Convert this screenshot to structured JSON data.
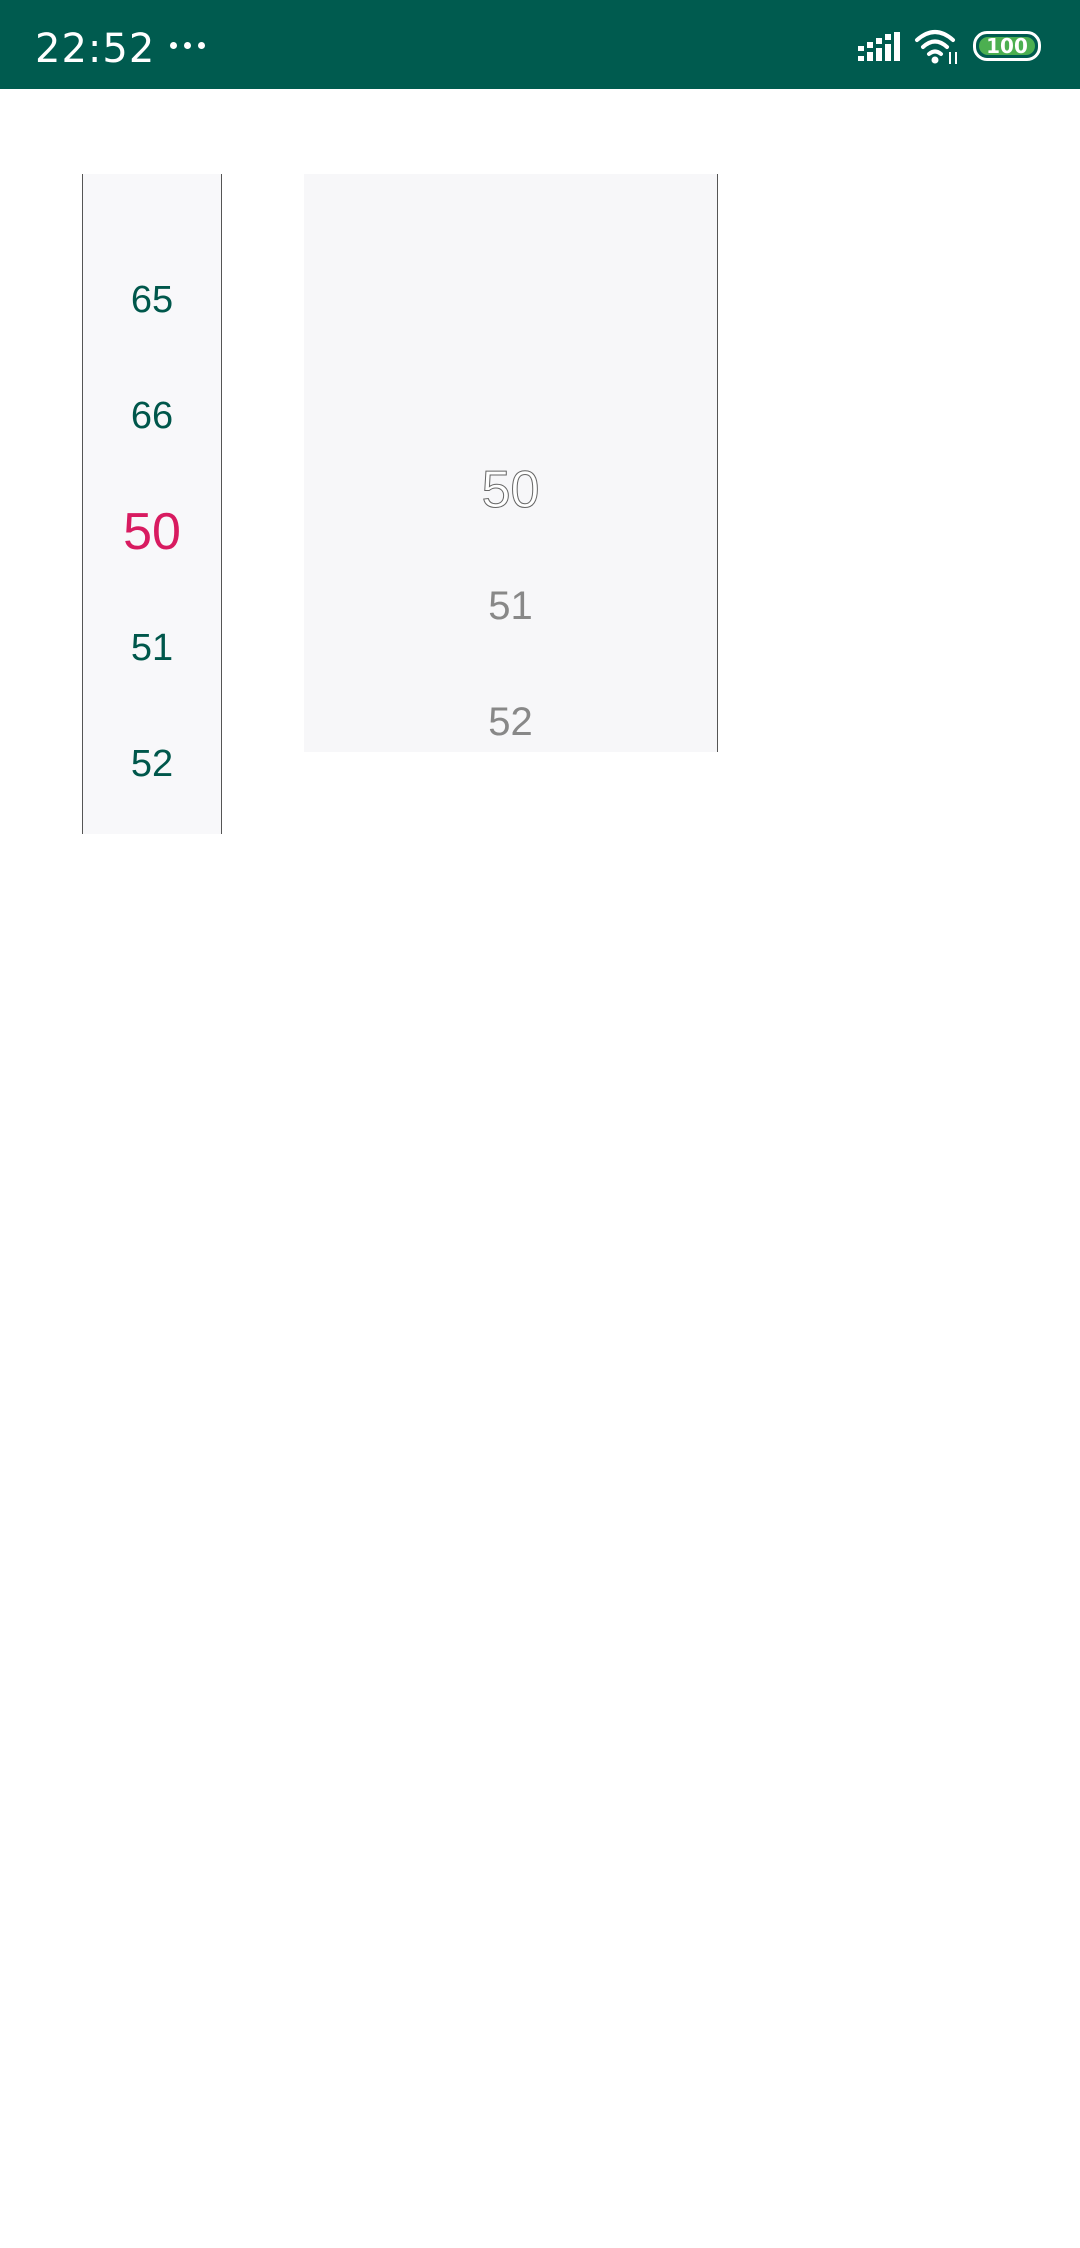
{
  "status_bar": {
    "time": "22:52",
    "battery_level": "100",
    "background_color": "#005b4f",
    "icons": [
      "more-dots-icon",
      "signal-icon",
      "wifi-icon",
      "battery-icon"
    ]
  },
  "picker_left": {
    "items": [
      "65",
      "66",
      "50",
      "51",
      "52"
    ],
    "selected_index": 2,
    "text_color": "#00574b",
    "selected_color": "#d81b60"
  },
  "picker_right": {
    "items": [
      "50",
      "51",
      "52"
    ],
    "selected_index": 0,
    "text_color": "#888888"
  }
}
